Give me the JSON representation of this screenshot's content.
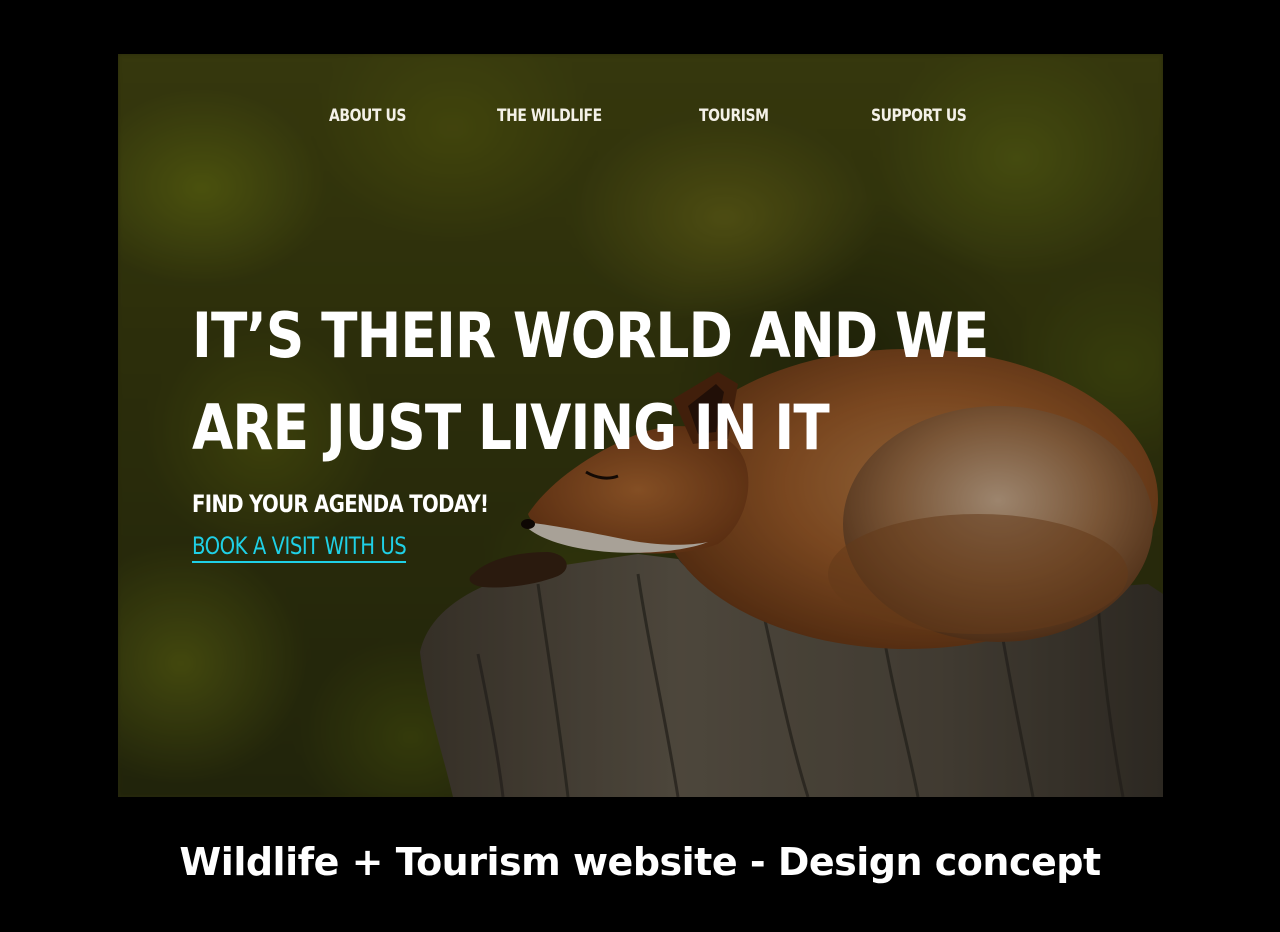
{
  "nav": {
    "items": [
      {
        "label": "ABOUT US"
      },
      {
        "label": "THE WILDLIFE"
      },
      {
        "label": "TOURISM"
      },
      {
        "label": "SUPPORT US"
      }
    ]
  },
  "hero": {
    "headline_line1": "IT’S THEIR WORLD AND WE",
    "headline_line2": "ARE JUST LIVING IN IT",
    "agenda": "FIND YOUR AGENDA TODAY!",
    "cta_link": "BOOK A VISIT WITH US",
    "image_subject": "fox sleeping on tree stump"
  },
  "caption": {
    "text": "Wildlife + Tourism website - Design concept"
  },
  "colors": {
    "page_background": "#000000",
    "nav_text": "#f4f1e8",
    "headline_text": "#ffffff",
    "link_accent": "#1fd0e6",
    "caption_text": "#ffffff"
  }
}
